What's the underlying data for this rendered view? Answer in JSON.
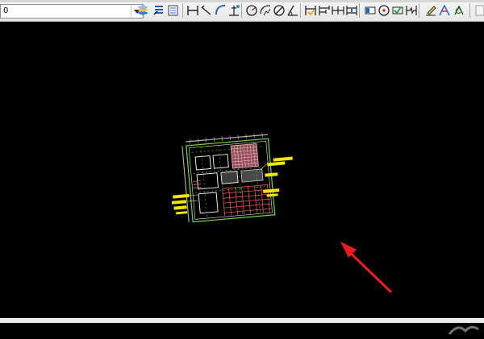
{
  "toolbar": {
    "layer_value": "0",
    "icons": [
      "layer-manager-icon",
      "layer-previous-icon",
      "layer-states-icon",
      "linear-dimension-icon",
      "aligned-dimension-icon",
      "arc-length-icon",
      "ordinate-dimension-icon",
      "radius-dimension-icon",
      "jogged-dimension-icon",
      "diameter-dimension-icon",
      "angular-dimension-icon",
      "quick-dimension-icon",
      "baseline-dimension-icon",
      "continue-dimension-icon",
      "dimension-space-icon",
      "tolerance-icon",
      "center-mark-icon",
      "inspection-icon",
      "jogged-linear-icon",
      "dimension-edit-icon",
      "dimension-text-edit-icon",
      "dimension-update-icon"
    ]
  },
  "colors": {
    "toolbar_background": "#ececec",
    "canvas_background": "#000000",
    "drawing_frame": "#6fdc3a",
    "drawing_grid": "#ff5c5c",
    "drawing_labels": "#f2e500",
    "arrow": "#ee1c1c"
  }
}
